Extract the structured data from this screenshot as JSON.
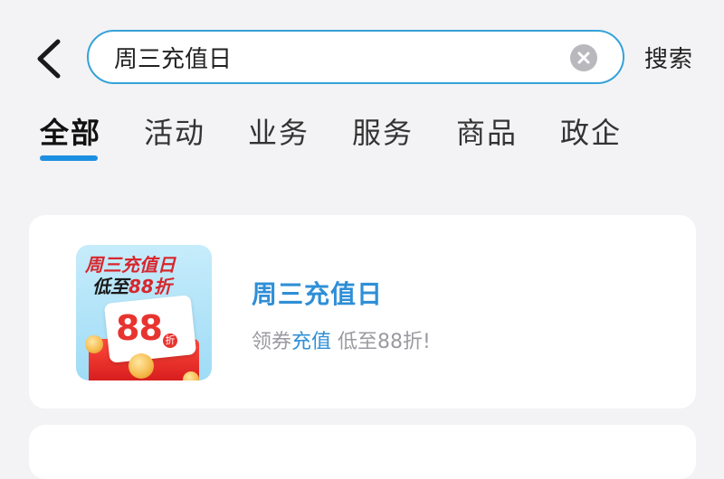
{
  "search": {
    "value": "周三充值日",
    "button_label": "搜索"
  },
  "tabs": [
    {
      "label": "全部",
      "active": true
    },
    {
      "label": "活动",
      "active": false
    },
    {
      "label": "业务",
      "active": false
    },
    {
      "label": "服务",
      "active": false
    },
    {
      "label": "商品",
      "active": false
    },
    {
      "label": "政企",
      "active": false
    }
  ],
  "results": [
    {
      "title": "周三充值日",
      "desc_prefix": "领券",
      "desc_keyword": "充值",
      "desc_suffix": " 低至88折!",
      "thumbnail": {
        "line1": "周三充值日",
        "line2_prefix": "低至",
        "line2_highlight": "88折",
        "number": "88",
        "unit": "折"
      }
    }
  ],
  "colors": {
    "accent": "#2f8fd6",
    "search_border": "#35a2d8",
    "tab_indicator": "#1d8fe0",
    "background": "#f3f3f5"
  },
  "icons": {
    "back": "chevron-left-icon",
    "clear": "clear-circle-icon"
  }
}
